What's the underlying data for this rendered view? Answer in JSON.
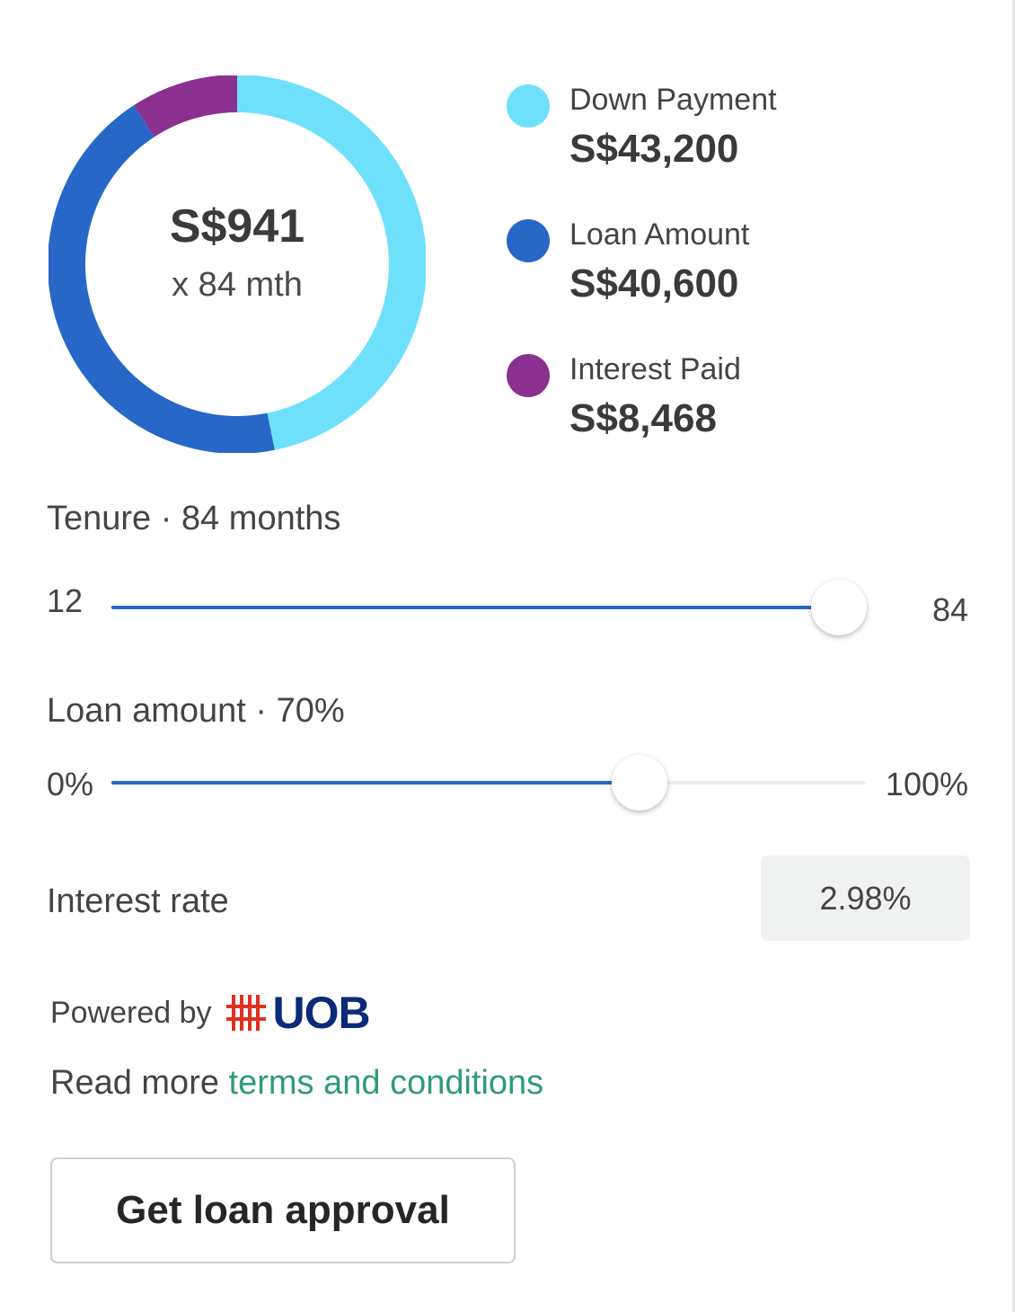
{
  "summary": {
    "monthly_payment": "S$941",
    "tenure_short": "x 84 mth"
  },
  "chart_data": {
    "type": "pie",
    "categories": [
      "Down Payment",
      "Loan Amount",
      "Interest Paid"
    ],
    "values": [
      43200,
      40600,
      8468
    ],
    "colors": [
      "#6ee0fb",
      "#2767c8",
      "#8b3192"
    ],
    "start_angle_deg": 0,
    "hole": true,
    "legend": "right"
  },
  "legend": {
    "items": [
      {
        "label": "Down Payment",
        "value": "S$43,200",
        "color": "#6ee0fb"
      },
      {
        "label": "Loan Amount",
        "value": "S$40,600",
        "color": "#2767c8"
      },
      {
        "label": "Interest Paid",
        "value": "S$8,468",
        "color": "#8b3192"
      }
    ]
  },
  "tenure": {
    "title": "Tenure · 84 months",
    "min_label": "12",
    "max_label": "84",
    "min": 12,
    "max": 84,
    "value": 84
  },
  "loan_amount": {
    "title": "Loan amount · 70%",
    "min_label": "0%",
    "max_label": "100%",
    "min": 0,
    "max": 100,
    "value": 70
  },
  "interest": {
    "label": "Interest rate",
    "value": "2.98%"
  },
  "powered_by": {
    "text": "Powered by",
    "brand": "UOB",
    "brand_color": "#0c2a7a",
    "mark_color": "#e0301e"
  },
  "read_more": {
    "prefix": "Read more ",
    "link_text": "terms and conditions"
  },
  "cta": {
    "label": "Get loan approval"
  }
}
